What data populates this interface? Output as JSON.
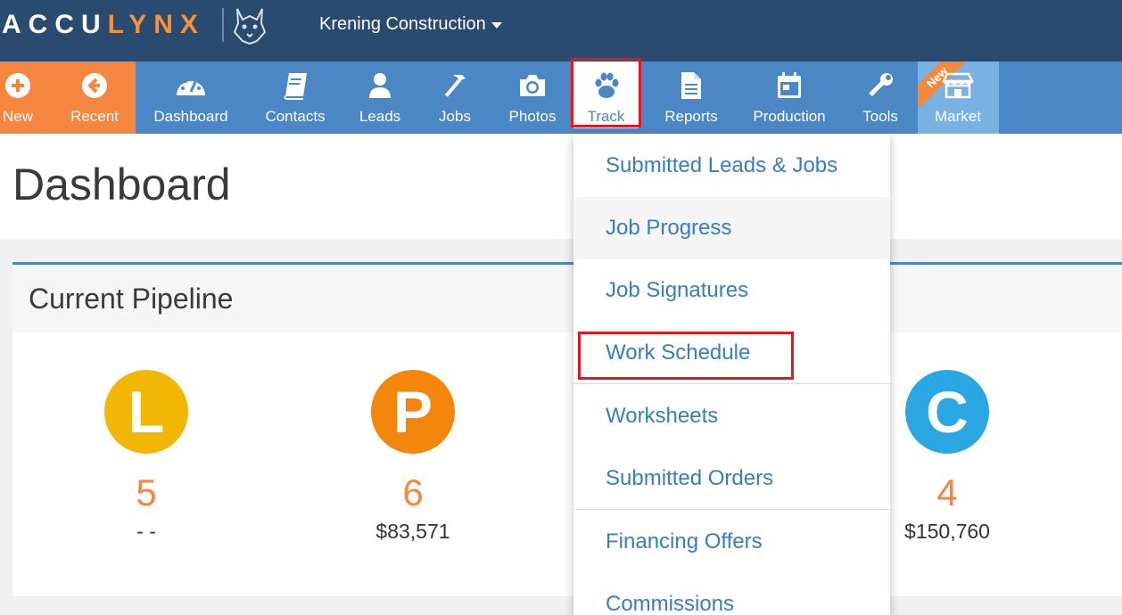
{
  "header": {
    "logo_part1": "ACCU",
    "logo_part2": "LYNX",
    "company": "Krening Construction"
  },
  "nav": {
    "new": "New",
    "recent": "Recent",
    "dashboard": "Dashboard",
    "contacts": "Contacts",
    "leads": "Leads",
    "jobs": "Jobs",
    "photos": "Photos",
    "track": "Track",
    "reports": "Reports",
    "production": "Production",
    "tools": "Tools",
    "market": "Market",
    "market_badge": "New"
  },
  "page": {
    "title": "Dashboard"
  },
  "pipeline": {
    "title": "Current Pipeline",
    "stages": [
      {
        "letter": "L",
        "count": "5",
        "amount": "- -",
        "color": "#f2b705"
      },
      {
        "letter": "P",
        "count": "6",
        "amount": "$83,571",
        "color": "#f5860c"
      },
      {
        "letter": "C",
        "count": "4",
        "amount": "$150,760",
        "color": "#2aa6e3"
      }
    ]
  },
  "track_menu": {
    "items": [
      "Submitted Leads & Jobs",
      "Job Progress",
      "Job Signatures",
      "Work Schedule",
      "Worksheets",
      "Submitted Orders",
      "Financing Offers",
      "Commissions"
    ]
  },
  "colors": {
    "header_bg": "#2b4a6f",
    "nav_bg": "#4b86c5",
    "accent_orange": "#f5853f",
    "highlight_red": "#e0191e",
    "link_blue": "#3a7cc0"
  }
}
